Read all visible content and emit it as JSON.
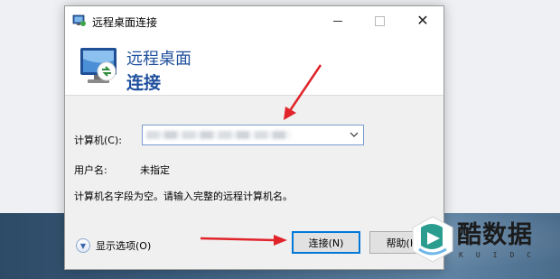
{
  "window": {
    "title": "远程桌面连接",
    "controls": {
      "minimize": "minimize",
      "maximize": "maximize",
      "close": "✕"
    }
  },
  "header": {
    "title": "远程桌面",
    "subtitle": "连接"
  },
  "form": {
    "computer_label": "计算机(C):",
    "computer_value": "",
    "user_label": "用户名:",
    "user_value": "未指定",
    "hint": "计算机名字段为空。请输入完整的远程计算机名。"
  },
  "buttons": {
    "show_options": "显示选项(O)",
    "connect": "连接(N)",
    "help": "帮助(H)"
  },
  "watermark": {
    "text": "酷数据",
    "sub": "KUIDC"
  },
  "icons": [
    "remote-desktop-icon",
    "chevron-down-icon",
    "options-chevron-icon",
    "annotation-arrow-icon",
    "watermark-logo-icon"
  ],
  "colors": {
    "accent": "#0078d7",
    "header_text": "#1e4f9c",
    "annotation_arrow": "#e0242a"
  }
}
